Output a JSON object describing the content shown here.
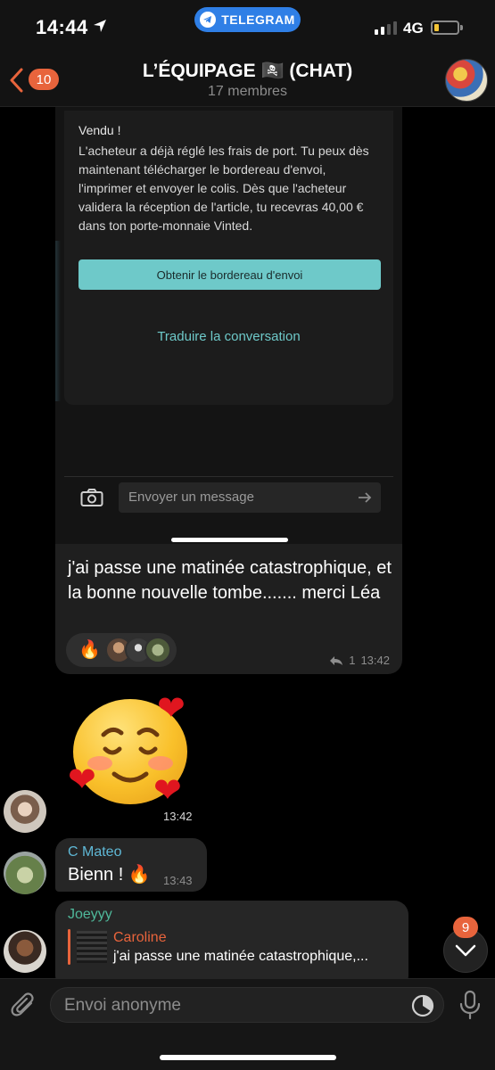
{
  "status_bar": {
    "time": "14:44",
    "app_pill": "TELEGRAM",
    "network": "4G"
  },
  "header": {
    "back_badge": "10",
    "title": "L’ÉQUIPAGE 🏴‍☠️ (CHAT)",
    "subtitle": "17 membres"
  },
  "screenshot_card": {
    "title": "Vendu !",
    "body": "L'acheteur a déjà réglé les frais de port. Tu peux dès maintenant télécharger le bordereau d'envoi, l'imprimer et envoyer le colis. Dès que l'acheteur validera la réception de l'article, tu recevras 40,00 € dans ton porte-monnaie Vinted.",
    "button": "Obtenir le bordereau d'envoi",
    "translate": "Traduire la conversation",
    "send_placeholder": "Envoyer un message"
  },
  "message1": {
    "text": "j'ai passe une matinée catastrophique, et la bonne nouvelle tombe....... merci Léa",
    "reaction_emoji": "🔥",
    "reply_count": "1",
    "time": "13:42"
  },
  "sticker": {
    "time": "13:42"
  },
  "message_mateo": {
    "sender": "C Mateo",
    "text": "Bienn ! 🔥",
    "time": "13:43",
    "sender_color": "#5fb8d6"
  },
  "message_joey": {
    "sender": "Joeyyy",
    "sender_color": "#4fb89a",
    "reply_name": "Caroline",
    "reply_text": "j'ai passe une matinée catastrophique,..."
  },
  "scroll_badge": "9",
  "input": {
    "placeholder": "Envoi anonyme"
  },
  "colors": {
    "accent": "#e8643c",
    "telegram_blue": "#2f7fe6",
    "vinted_teal": "#6ec9c9"
  }
}
